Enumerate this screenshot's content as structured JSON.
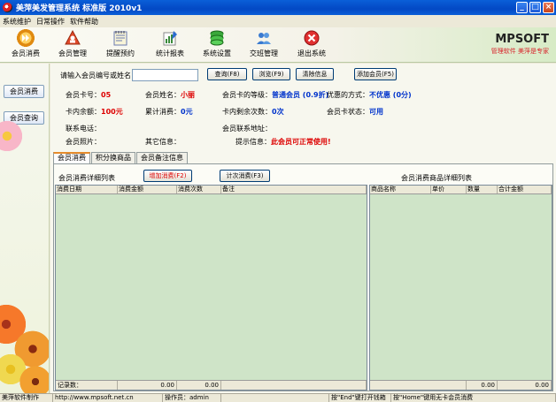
{
  "window": {
    "title": "美萍美发管理系统 标准版 2010v1",
    "minimize": "_",
    "maximize": "□",
    "close": "×"
  },
  "menu": [
    "系统维护",
    "日常操作",
    "软件帮助"
  ],
  "toolbar": {
    "buttons": [
      {
        "label": "会员消费",
        "icon": "forward-icon",
        "color": "#f0a020"
      },
      {
        "label": "会员管理",
        "icon": "user-manage-icon",
        "color": "#d84a2a"
      },
      {
        "label": "提醒预约",
        "icon": "notepad-icon",
        "color": "#7a9acb"
      },
      {
        "label": "统计报表",
        "icon": "report-icon",
        "color": "#4a9a4a"
      },
      {
        "label": "系统设置",
        "icon": "settings-stack-icon",
        "color": "#2f9a3a"
      },
      {
        "label": "交班管理",
        "icon": "shift-icon",
        "color": "#3a7ad0"
      },
      {
        "label": "退出系统",
        "icon": "exit-icon",
        "color": "#d82a2a"
      }
    ],
    "logo_brand": "MPSOFT",
    "logo_slogan": "管理软件 美萍是专家"
  },
  "sidebar": {
    "buttons": [
      "会员消费",
      "会员查询"
    ]
  },
  "search": {
    "label": "请输入会员编号或姓名",
    "value": "",
    "buttons": [
      "查询(F8)",
      "浏览(F9)",
      "清除信息",
      "添加会员(F5)"
    ]
  },
  "member": {
    "card_no_label": "会员卡号：",
    "card_no": "05",
    "name_label": "会员姓名：",
    "name": "小丽",
    "level_label": "会员卡的等级：",
    "level": "普通会员 (0.9折)",
    "discount_label": "优惠的方式：",
    "discount": "不优惠 (0分)",
    "balance_label": "卡内余额：",
    "balance": "100元",
    "total_label": "累计消费：",
    "total": "0元",
    "times_label": "卡内剩余次数：",
    "times": "0次",
    "status_label": "会员卡状态：",
    "status": "可用",
    "phone_label": "联系电话：",
    "address_label": "会员联系地址：",
    "photo_label": "会员照片：",
    "other_label": "其它信息：",
    "tip_label": "提示信息：",
    "tip": "此会员可正常使用!"
  },
  "tabs": [
    "会员消费",
    "积分换商品",
    "会员备注信息"
  ],
  "consume": {
    "detail_title": "会员消费详细列表",
    "add_button": "增加消费(F2)",
    "count_button": "计次消费(F3)",
    "goods_title": "会员消费商品详细列表",
    "left_columns": [
      "消费日期",
      "消费金额",
      "消费次数",
      "备注"
    ],
    "right_columns": [
      "商品名称",
      "单价",
      "数量",
      "合计金额"
    ],
    "left_footer": [
      "记录数：",
      "0.00",
      "0.00"
    ],
    "right_footer": [
      "0.00",
      "0.00"
    ]
  },
  "status": {
    "cells": [
      "美萍软件制作",
      "http://www.mpsoft.net.cn",
      "操作员：admin",
      "",
      "按\"End\"键打开钱箱",
      "按\"Home\"键用无卡会员消费"
    ]
  },
  "colors": {
    "title_bar": "#0a5fd8",
    "grid_bg": "#cfe4c8",
    "highlight_red": "#d00000",
    "highlight_blue": "#0033cc"
  }
}
